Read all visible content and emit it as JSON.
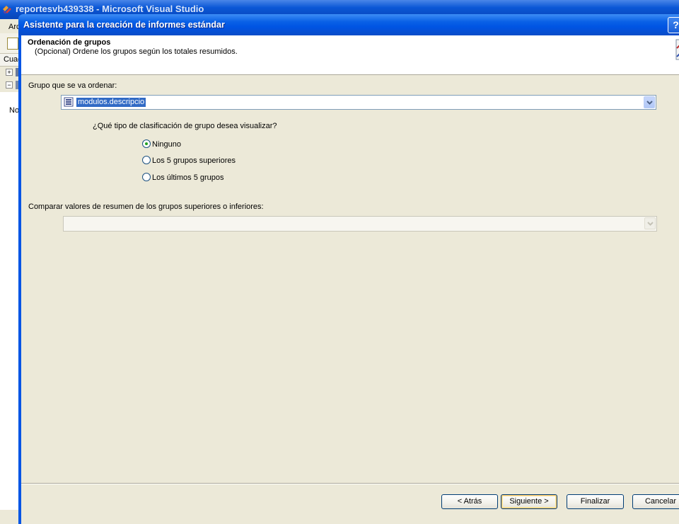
{
  "vs_window": {
    "title": "reportesvb439338 - Microsoft Visual Studio",
    "menu_partial": "Arc",
    "panel_partial": "Cuad",
    "body_partial": "No"
  },
  "dialog": {
    "title": "Asistente para la creación de informes estándar",
    "help_label": "?",
    "header": {
      "title": "Ordenación de grupos",
      "subtitle": "(Opcional) Ordene los grupos según los totales resumidos."
    },
    "group_label": "Grupo que se va ordenar:",
    "group_combo_value": "modulos.descripcio",
    "sort_question": "¿Qué tipo de clasificación de grupo desea visualizar?",
    "radio_options": [
      {
        "label": "Ninguno",
        "selected": true
      },
      {
        "label": "Los 5 grupos superiores",
        "selected": false
      },
      {
        "label": "Los últimos 5 grupos",
        "selected": false
      }
    ],
    "compare_label": "Comparar valores de resumen de los grupos superiores o inferiores:",
    "compare_combo_value": "",
    "buttons": {
      "back": "< Atrás",
      "next": "Siguiente >",
      "finish": "Finalizar",
      "cancel": "Cancelar"
    }
  },
  "colors": {
    "title_bar": "#0054e3",
    "selection": "#316ac5",
    "dialog_bg": "#ece9d8",
    "radio_dot": "#21a121"
  },
  "icons": [
    "vs-app-icon",
    "field-icon",
    "chevron-down-icon",
    "help-icon",
    "wizard-header-icon"
  ]
}
